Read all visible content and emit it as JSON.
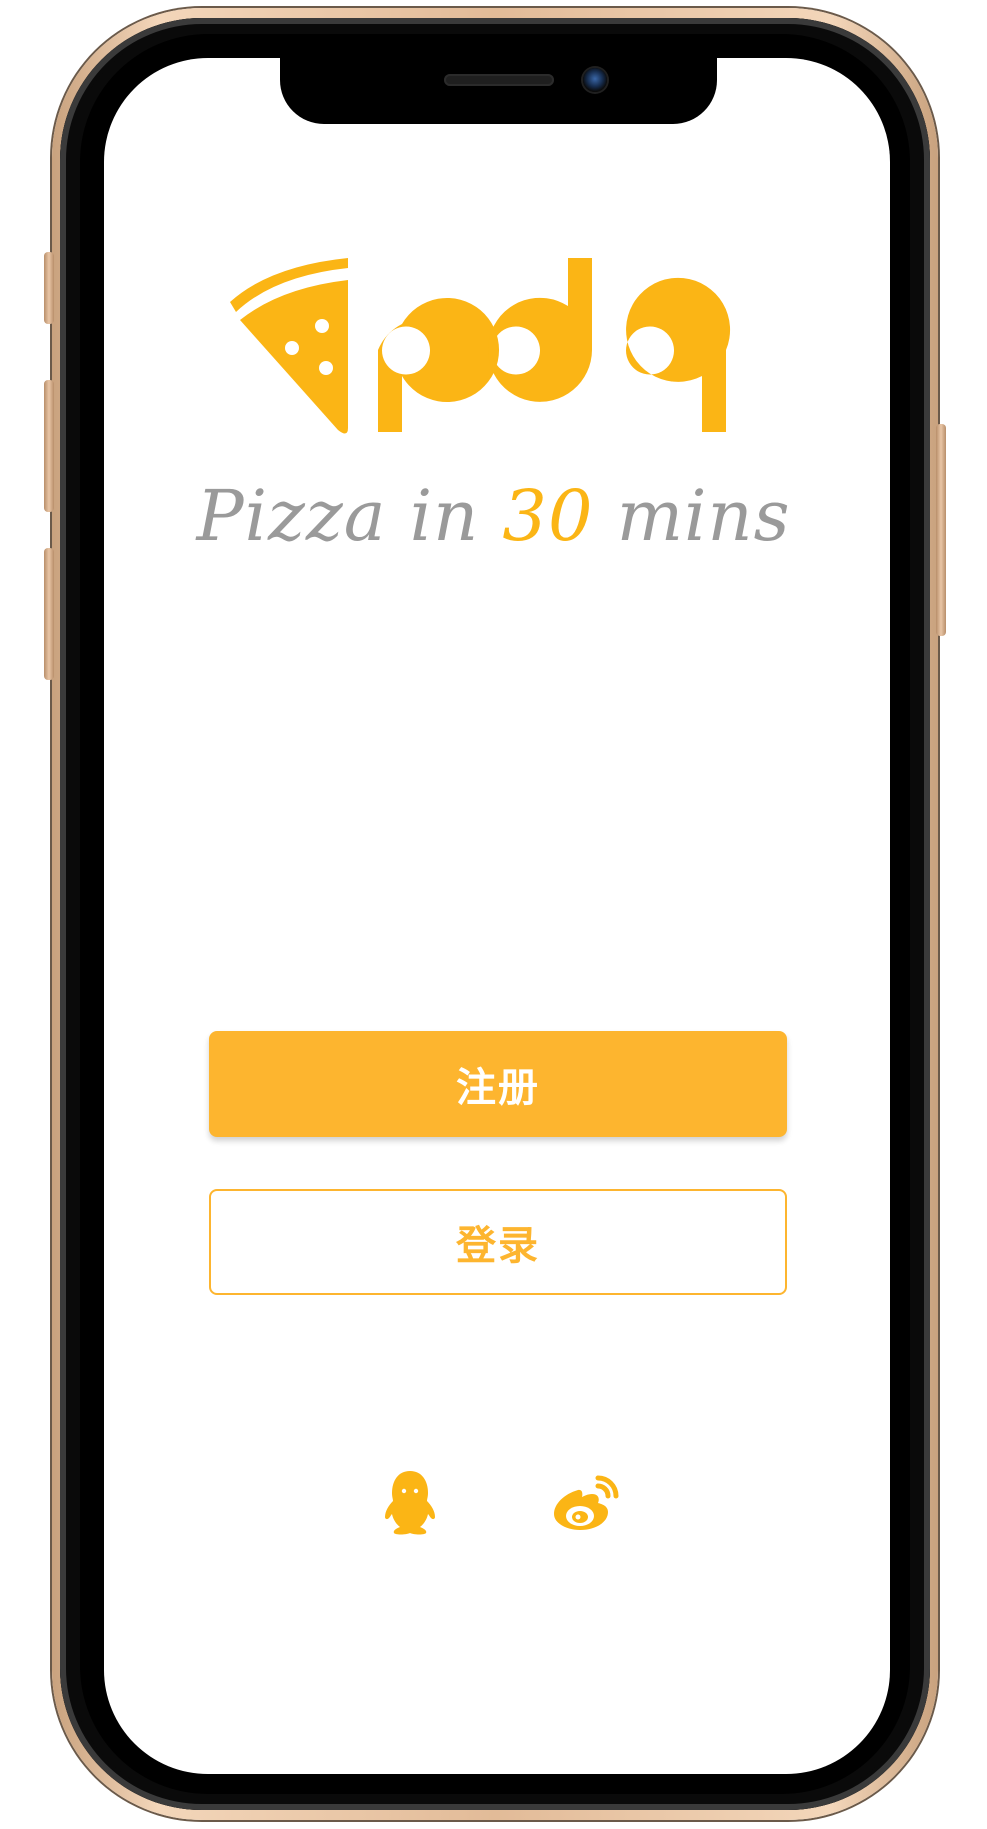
{
  "brand": {
    "wordmark": "pdq",
    "tagline_before": "Pizza in ",
    "tagline_accent": "30",
    "tagline_after": " mins",
    "accent_color": "#fbb515",
    "muted_color": "#9a9a9a"
  },
  "buttons": {
    "register_label": "注册",
    "login_label": "登录",
    "primary_color": "#fdb52f"
  },
  "social": [
    {
      "icon": "qq-penguin-icon"
    },
    {
      "icon": "weibo-icon"
    }
  ]
}
